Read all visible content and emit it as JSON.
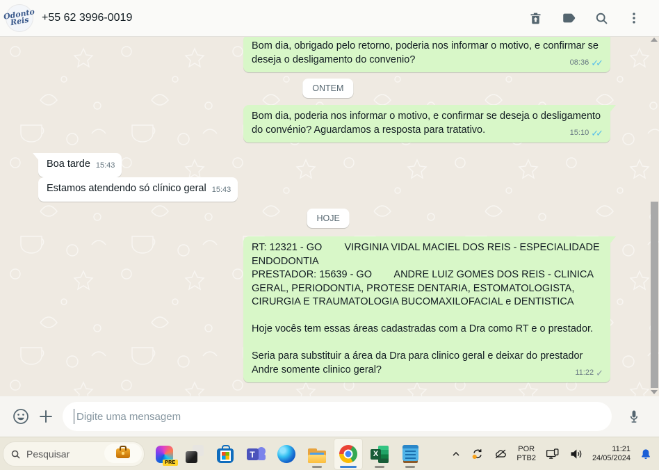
{
  "header": {
    "contact": "+55 62 3996-0019",
    "avatar": {
      "line1": "Odonto",
      "line2": "Reis"
    }
  },
  "chat": {
    "dividers": {
      "yesterday": "ONTEM",
      "today": "HOJE"
    },
    "icons": {
      "double_check": "✓✓",
      "single_check": "✓"
    },
    "messages": [
      {
        "direction": "out",
        "text": "Bom dia, obrigado pelo retorno, poderia nos informar o motivo, e confirmar se deseja o desligamento do convenio?",
        "time": "08:36",
        "status": "read"
      },
      {
        "direction": "out",
        "text": "Bom dia, poderia nos informar o motivo, e confirmar se deseja o desligamento do convénio? Aguardamos a resposta para tratativo.",
        "time": "15:10",
        "status": "read"
      },
      {
        "direction": "in",
        "text": "Boa tarde",
        "time": "15:43"
      },
      {
        "direction": "in",
        "text": "Estamos atendendo só clínico geral",
        "time": "15:43"
      },
      {
        "direction": "out",
        "text": "RT: 12321 - GO        VIRGINIA VIDAL MACIEL DOS REIS - ESPECIALIDADE ENDODONTIA\nPRESTADOR: 15639 - GO        ANDRE LUIZ GOMES DOS REIS - CLINICA GERAL, PERIODONTIA, PROTESE DENTARIA, ESTOMATOLOGISTA, CIRURGIA E TRAUMATOLOGIA BUCOMAXILOFACIAL e DENTISTICA\n\nHoje vocês tem essas áreas cadastradas com a Dra como RT e o prestador.\n\nSeria para substituir a área da Dra para clinico geral e deixar do prestador Andre somente clinico geral?",
        "time": "11:22",
        "status": "sent"
      }
    ]
  },
  "composer": {
    "placeholder": "Digite uma mensagem"
  },
  "taskbar": {
    "search_label": "Pesquisar",
    "copilot_badge": "PRE",
    "teams_letter": "T",
    "excel_letter": "X",
    "tray": {
      "language_line1": "POR",
      "language_line2": "PTB2",
      "time": "11:21",
      "date": "24/05/2024"
    }
  },
  "colors": {
    "chat_background": "#efeae2",
    "bubble_outgoing": "#d8f7c8",
    "bubble_incoming": "#ffffff",
    "check_read_blue": "#53bdeb",
    "check_sent_gray": "#8696a0",
    "header_icon_gray": "#54656f",
    "notification_bell_blue": "#1b5fd6",
    "chrome_active_indicator": "#3b82d6"
  }
}
